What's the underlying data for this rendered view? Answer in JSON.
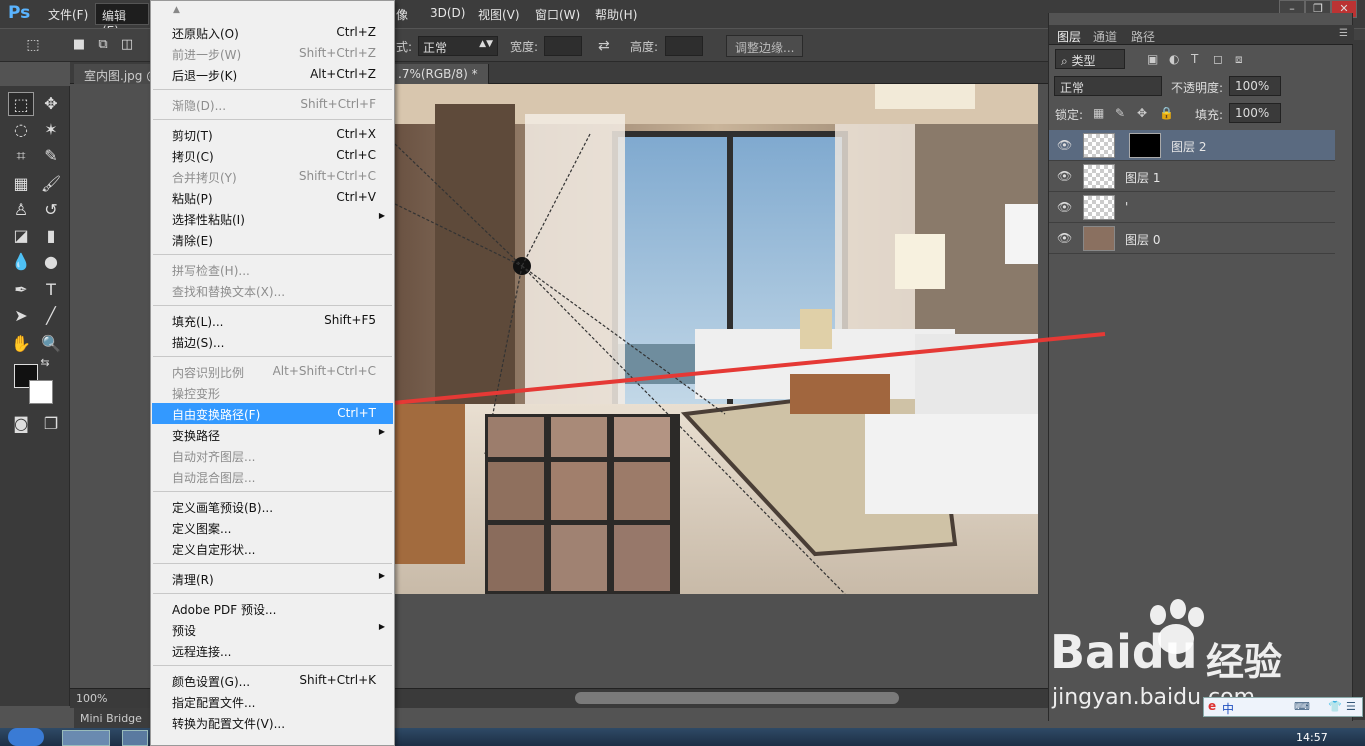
{
  "app": {
    "logo": "Ps"
  },
  "menubar": {
    "items": [
      "文件(F)",
      "编辑(E)",
      "3D(D)",
      "视图(V)",
      "窗口(W)",
      "帮助(H)"
    ],
    "partial_item": "像"
  },
  "options_bar": {
    "style_label": "式:",
    "style_value": "正常",
    "width_label": "宽度:",
    "height_label": "高度:",
    "refine_edge": "调整边缘..."
  },
  "doc_tabs": [
    {
      "label": "室内图.jpg @"
    },
    {
      "label": ".7%(RGB/8) *"
    }
  ],
  "status": {
    "zoom": "100%"
  },
  "mini_bridge": "Mini Bridge",
  "layers_panel": {
    "tabs": [
      "图层",
      "通道",
      "路径"
    ],
    "filter_kind": "类型",
    "blend_mode": "正常",
    "opacity_label": "不透明度:",
    "opacity_value": "100%",
    "lock_label": "锁定:",
    "fill_label": "填充:",
    "fill_value": "100%",
    "layers": [
      {
        "name": "图层 2",
        "selected": true
      },
      {
        "name": "图层 1",
        "selected": false
      },
      {
        "name": "'",
        "selected": false
      },
      {
        "name": "图层 0",
        "selected": false
      }
    ]
  },
  "edit_menu": {
    "groups": [
      [
        {
          "label": "还原贴入(O)",
          "shortcut": "Ctrl+Z",
          "disabled": false
        },
        {
          "label": "前进一步(W)",
          "shortcut": "Shift+Ctrl+Z",
          "disabled": true
        },
        {
          "label": "后退一步(K)",
          "shortcut": "Alt+Ctrl+Z",
          "disabled": false
        }
      ],
      [
        {
          "label": "渐隐(D)...",
          "shortcut": "Shift+Ctrl+F",
          "disabled": true
        }
      ],
      [
        {
          "label": "剪切(T)",
          "shortcut": "Ctrl+X",
          "disabled": false
        },
        {
          "label": "拷贝(C)",
          "shortcut": "Ctrl+C",
          "disabled": false
        },
        {
          "label": "合并拷贝(Y)",
          "shortcut": "Shift+Ctrl+C",
          "disabled": true
        },
        {
          "label": "粘贴(P)",
          "shortcut": "Ctrl+V",
          "disabled": false
        },
        {
          "label": "选择性粘贴(I)",
          "shortcut": "",
          "disabled": false,
          "submenu": true
        },
        {
          "label": "清除(E)",
          "shortcut": "",
          "disabled": false
        }
      ],
      [
        {
          "label": "拼写检查(H)...",
          "shortcut": "",
          "disabled": true
        },
        {
          "label": "查找和替换文本(X)...",
          "shortcut": "",
          "disabled": true
        }
      ],
      [
        {
          "label": "填充(L)...",
          "shortcut": "Shift+F5",
          "disabled": false
        },
        {
          "label": "描边(S)...",
          "shortcut": "",
          "disabled": false
        }
      ],
      [
        {
          "label": "内容识别比例",
          "shortcut": "Alt+Shift+Ctrl+C",
          "disabled": true
        },
        {
          "label": "操控变形",
          "shortcut": "",
          "disabled": true
        },
        {
          "label": "自由变换路径(F)",
          "shortcut": "Ctrl+T",
          "disabled": false,
          "highlighted": true
        },
        {
          "label": "变换路径",
          "shortcut": "",
          "disabled": false,
          "submenu": true
        },
        {
          "label": "自动对齐图层...",
          "shortcut": "",
          "disabled": true
        },
        {
          "label": "自动混合图层...",
          "shortcut": "",
          "disabled": true
        }
      ],
      [
        {
          "label": "定义画笔预设(B)...",
          "shortcut": "",
          "disabled": false
        },
        {
          "label": "定义图案...",
          "shortcut": "",
          "disabled": false
        },
        {
          "label": "定义自定形状...",
          "shortcut": "",
          "disabled": false
        }
      ],
      [
        {
          "label": "清理(R)",
          "shortcut": "",
          "disabled": false,
          "submenu": true
        }
      ],
      [
        {
          "label": "Adobe PDF 预设...",
          "shortcut": "",
          "disabled": false
        },
        {
          "label": "预设",
          "shortcut": "",
          "disabled": false,
          "submenu": true
        },
        {
          "label": "远程连接...",
          "shortcut": "",
          "disabled": false
        }
      ],
      [
        {
          "label": "颜色设置(G)...",
          "shortcut": "Shift+Ctrl+K",
          "disabled": false
        },
        {
          "label": "指定配置文件...",
          "shortcut": "",
          "disabled": false
        },
        {
          "label": "转换为配置文件(V)...",
          "shortcut": "",
          "disabled": false
        }
      ]
    ]
  },
  "watermark": {
    "brand": "Baidu",
    "cn": "经验",
    "url": "jingyan.baidu.com"
  },
  "ime": {
    "label": "中"
  },
  "taskbar": {
    "clock": "14:57"
  },
  "colors": {
    "accent": "#3399ff",
    "annotation_arrow": "#e53935"
  }
}
